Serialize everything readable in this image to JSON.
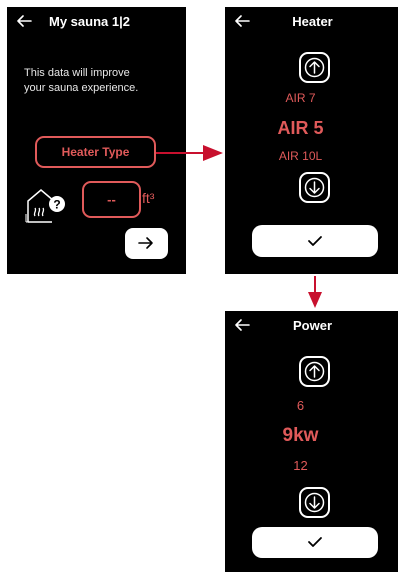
{
  "screen1": {
    "title": "My sauna 1|2",
    "info_line1": "This data will improve",
    "info_line2": "your sauna experience.",
    "heater_type_label": "Heater Type",
    "volume_value": "--",
    "volume_unit": "ft³",
    "icons": {
      "back": "back-arrow-icon",
      "sauna": "sauna-help-icon",
      "next": "next-arrow-icon"
    }
  },
  "screen2": {
    "title": "Heater",
    "options": [
      "AIR 7",
      "AIR 5",
      "AIR 10L"
    ],
    "selected": "AIR 5",
    "icons": {
      "up": "arrow-up-icon",
      "down": "arrow-down-icon",
      "confirm": "checkmark-icon"
    }
  },
  "screen3": {
    "title": "Power",
    "options": [
      "6",
      "9kw",
      "12"
    ],
    "selected": "9kw",
    "icons": {
      "up": "arrow-up-icon",
      "down": "arrow-down-icon",
      "confirm": "checkmark-icon"
    }
  },
  "colors": {
    "accent": "#e05a5a",
    "flow_arrow": "#c8102e",
    "screen_bg": "#000000"
  }
}
